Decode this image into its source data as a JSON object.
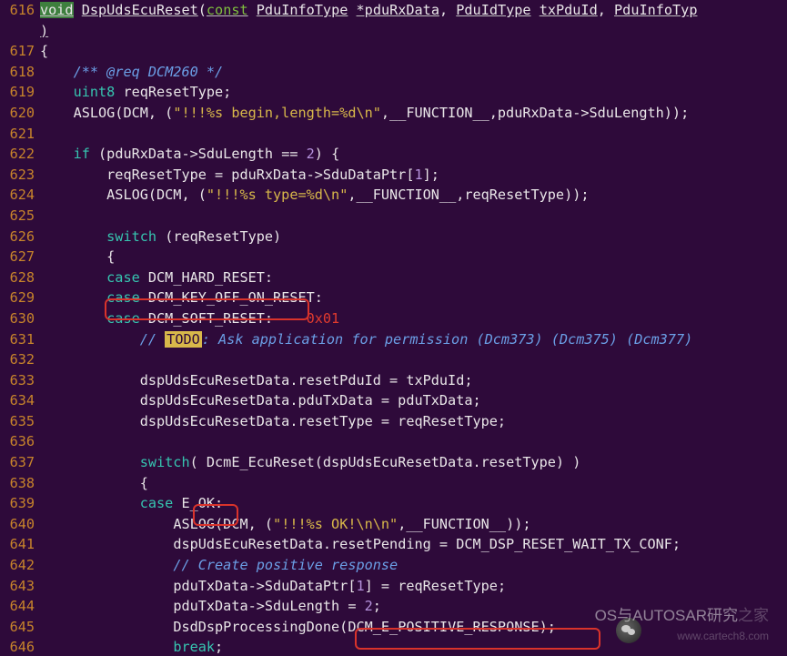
{
  "lines": [
    {
      "num": "616"
    },
    {
      "num": "617"
    },
    {
      "num": "618"
    },
    {
      "num": "619"
    },
    {
      "num": "620"
    },
    {
      "num": "621"
    },
    {
      "num": "622"
    },
    {
      "num": "623"
    },
    {
      "num": "624"
    },
    {
      "num": "625"
    },
    {
      "num": "626"
    },
    {
      "num": "627"
    },
    {
      "num": "628"
    },
    {
      "num": "629"
    },
    {
      "num": "630"
    },
    {
      "num": "631"
    },
    {
      "num": "632"
    },
    {
      "num": "633"
    },
    {
      "num": "634"
    },
    {
      "num": "635"
    },
    {
      "num": "636"
    },
    {
      "num": "637"
    },
    {
      "num": "638"
    },
    {
      "num": "639"
    },
    {
      "num": "640"
    },
    {
      "num": "641"
    },
    {
      "num": "642"
    },
    {
      "num": "643"
    },
    {
      "num": "644"
    },
    {
      "num": "645"
    },
    {
      "num": "646"
    }
  ],
  "t": {
    "void": "void",
    "fnName": "DspUdsEcuReset",
    "const": "const",
    "pduInfoType": "PduInfoType",
    "pduRxData": "*pduRxData",
    "pduIdType": "PduIdType",
    "txPduId": "txPduId",
    "pduInfoTypTail": "PduInfoTyp",
    "closeParen": ")",
    "obrace": "{",
    "cmtReq": "/** @req DCM260 */",
    "uint8": "uint8",
    "reqResetType": "reqResetType;",
    "aslog": "ASLOG(DCM, (",
    "str1": "\"!!!%s begin,length=%d\\n\"",
    "afterStr1": ",__FUNCTION__,pduRxData->SduLength));",
    "if": "if",
    "ifCond": "(pduRxData->SduLength ==",
    "two": "2",
    "ifEnd": ") {",
    "reqAssign": "reqResetType = pduRxData->SduDataPtr[",
    "one": "1",
    "reqAssignEnd": "];",
    "str2": "\"!!!%s type=%d\\n\"",
    "afterStr2": ",__FUNCTION__,reqResetType));",
    "switch": "switch",
    "switchArg": "(reqResetType)",
    "case": "case",
    "hardReset": "DCM_HARD_RESET:",
    "keyOff": "DCM_KEY_OFF_ON_RESET:",
    "softReset": "DCM_SOFT_RESET:",
    "hex01": "0x01",
    "todoPre": "// ",
    "todo": "TODO",
    "todoRest": ": Ask application for permission (Dcm373) (Dcm375) (Dcm377)",
    "dsp1": "dspUdsEcuResetData.resetPduId = txPduId;",
    "dsp2": "dspUdsEcuResetData.pduTxData = pduTxData;",
    "dsp3": "dspUdsEcuResetData.resetType = reqResetType;",
    "switch2": "switch",
    "switch2Arg": "( DcmE_EcuReset(dspUdsEcuResetData.resetType) )",
    "eok": "E_OK",
    "colon": ":",
    "str3": "\"!!!%s OK!\\n\\n\"",
    "afterStr3": ",__FUNCTION__));",
    "dsp4": "dspUdsEcuResetData.resetPending = DCM_DSP_RESET_WAIT_TX_CONF;",
    "cmtPos": "// Create positive response",
    "ptr1a": "pduTxData->SduDataPtr[",
    "ptr1b": "] = reqResetType;",
    "ptr2a": "pduTxData->SduLength = ",
    "ptr2b": ";",
    "dsd": "DsdDspProcessingDone(",
    "dsdArg": "DCM_E_POSITIVE_RESPONSE",
    "dsdEnd": ");",
    "break": "break",
    "semi": ";"
  },
  "watermark": {
    "line1": "OS与AUTOSAR研究",
    "suffix": "之家",
    "line2": "www.cartech8.com"
  }
}
